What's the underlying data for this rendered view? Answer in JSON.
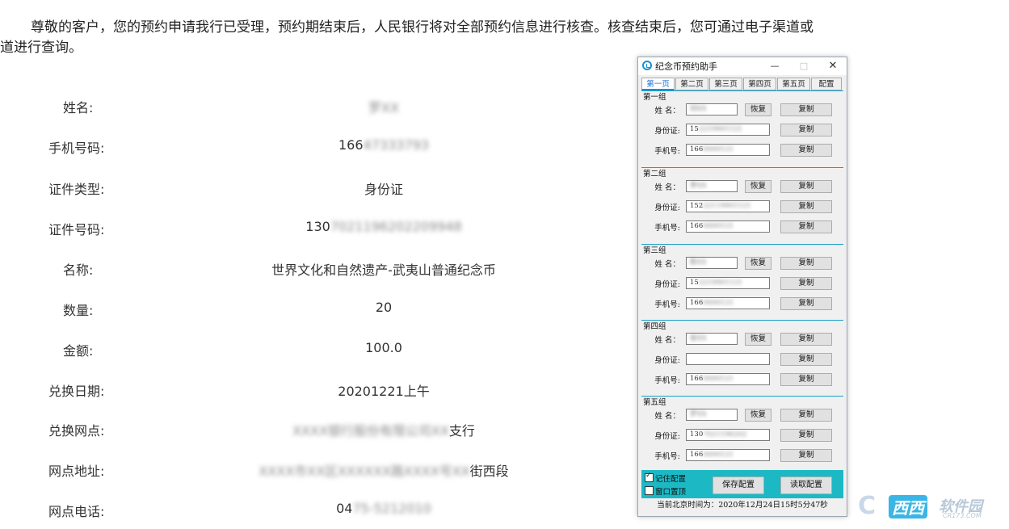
{
  "notice": {
    "line1": "尊敬的客户，您的预约申请我行已受理，预约期结束后，人民银行将对全部预约信息进行核查。核查结束后，您可通过电子渠道或",
    "line2": "道进行查询。"
  },
  "info": [
    {
      "label": "姓名:",
      "value_prefix": "",
      "value_blur": "罗XX",
      "value_suffix": ""
    },
    {
      "label": "手机号码:",
      "value_prefix": "166",
      "value_blur": "47333793",
      "value_suffix": ""
    },
    {
      "label": "证件类型:",
      "value_prefix": "身份证",
      "value_blur": "",
      "value_suffix": ""
    },
    {
      "label": "证件号码:",
      "value_prefix": "130",
      "value_blur": "7021196202209948",
      "value_suffix": ""
    },
    {
      "label": "名称:",
      "value_prefix": "世界文化和自然遗产-武夷山普通纪念币",
      "value_blur": "",
      "value_suffix": ""
    },
    {
      "label": "数量:",
      "value_prefix": "20",
      "value_blur": "",
      "value_suffix": ""
    },
    {
      "label": "金额:",
      "value_prefix": "100.0",
      "value_blur": "",
      "value_suffix": ""
    },
    {
      "label": "兑换日期:",
      "value_prefix": "20201221上午",
      "value_blur": "",
      "value_suffix": ""
    },
    {
      "label": "兑换网点:",
      "value_prefix": "",
      "value_blur": "XXXX银行股份有限公司XX",
      "value_suffix": "支行"
    },
    {
      "label": "网点地址:",
      "value_prefix": "",
      "value_blur": "XXXX市XX区XXXXXX路XXXX号XX",
      "value_suffix": "街西段"
    },
    {
      "label": "网点电话:",
      "value_prefix": "04",
      "value_blur": "75-5212010",
      "value_suffix": ""
    }
  ],
  "window": {
    "title": "纪念币预约助手",
    "minimize": "—",
    "maximize": "□",
    "close": "✕",
    "tabs": [
      "第一页",
      "第二页",
      "第三页",
      "第四页",
      "第五页",
      "配置"
    ],
    "labels": {
      "name": "姓 名：",
      "id": "身份证:",
      "phone": "手机号:"
    },
    "restore_label": "恢复",
    "copy_label": "复制",
    "groups": [
      {
        "title": "第一组",
        "name": "",
        "name_blur": "刘XX",
        "id": "15",
        "id_blur": "2219901121",
        "phone": "166",
        "phone_blur": "0000121"
      },
      {
        "title": "第二组",
        "name": "",
        "name_blur": "李XX",
        "id": "152",
        "id_blur": "22119901121",
        "phone": "166",
        "phone_blur": "0000121"
      },
      {
        "title": "第三组",
        "name": "",
        "name_blur": "陈XX",
        "id": "15",
        "id_blur": "2219901121",
        "phone": "166",
        "phone_blur": "0000121"
      },
      {
        "title": "第四组",
        "name": "",
        "name_blur": "张XX",
        "id": "",
        "id_blur": "",
        "phone": "166",
        "phone_blur": "0000121"
      },
      {
        "title": "第五组",
        "name": "",
        "name_blur": "罗XX",
        "id": "130",
        "id_blur": "7021196202",
        "phone": "166",
        "phone_blur": "0000121"
      }
    ],
    "remember_label": "记住配置",
    "remember_checked": true,
    "topmost_label": "窗口置顶",
    "topmost_checked": false,
    "save_label": "保存配置",
    "load_label": "读取配置",
    "status_text": "当前北京时间为：2020年12月24日15时5分47秒",
    "accent_color": "#1cb8c4"
  },
  "watermark": {
    "c": "C",
    "text": "西西",
    "text2": "软件园",
    "url": "CR173.COM"
  }
}
